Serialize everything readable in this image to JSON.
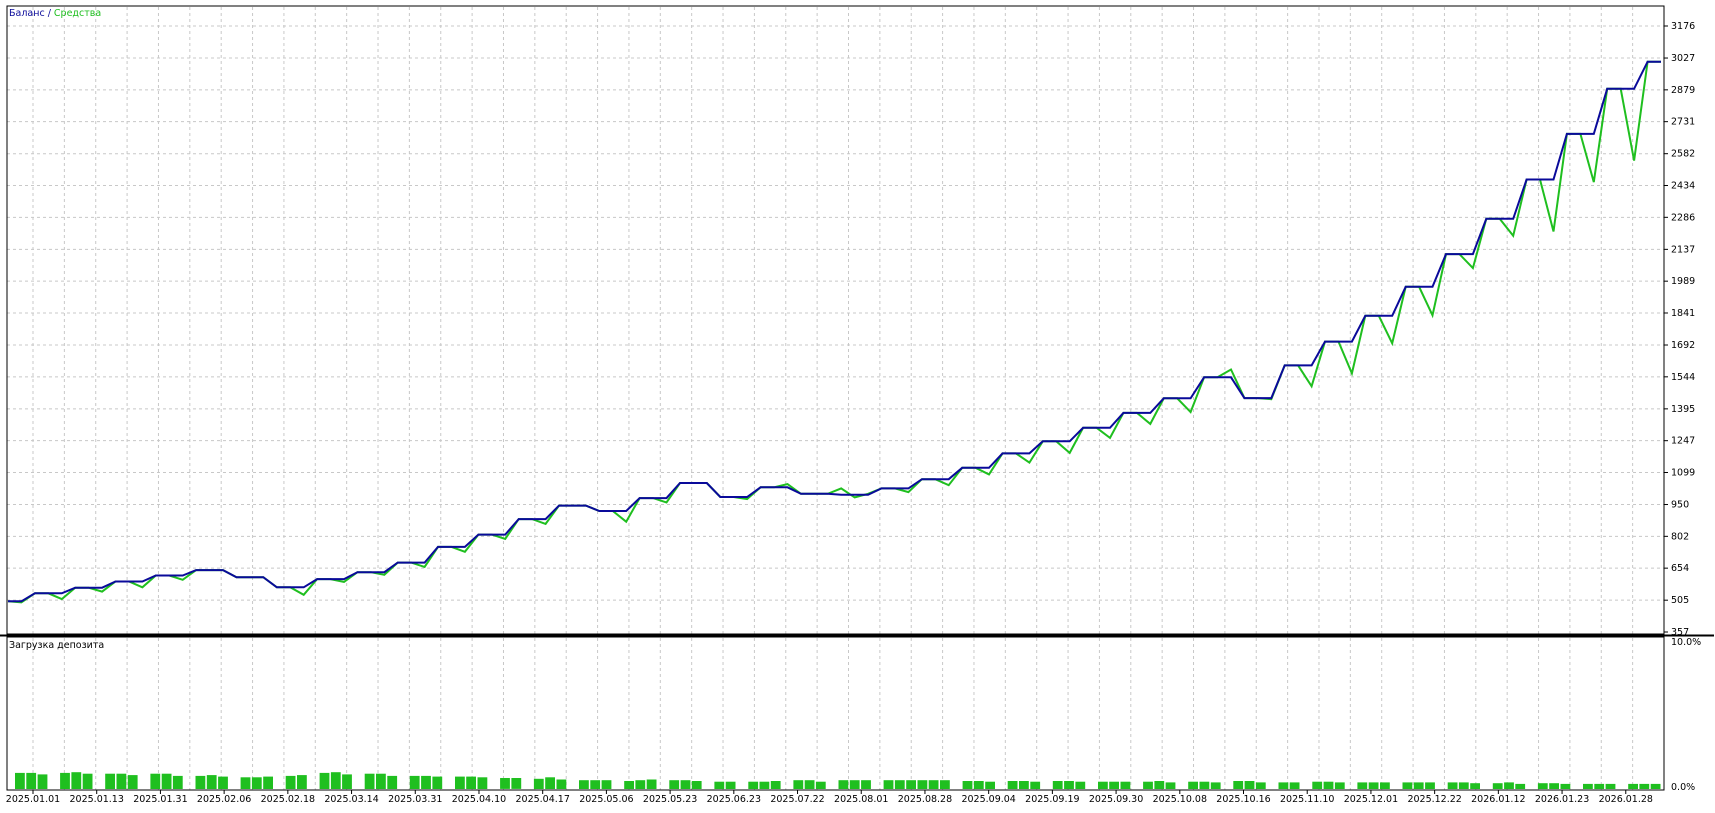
{
  "legend": {
    "balance_label": "Баланс",
    "separator": " / ",
    "equity_label": "Средства"
  },
  "colors": {
    "balance": "#0a0a9a",
    "equity": "#1fbf1f",
    "grid": "#c8c8c8",
    "frame": "#000000",
    "background": "#ffffff",
    "deposit_bars": "#1fbf1f"
  },
  "chart_data": [
    {
      "type": "line",
      "y_ticks": [
        "357",
        "505",
        "654",
        "802",
        "950",
        "1099",
        "1247",
        "1395",
        "1544",
        "1692",
        "1841",
        "1989",
        "2137",
        "2286",
        "2434",
        "2582",
        "2731",
        "2879",
        "3027",
        "3176"
      ],
      "ylim": [
        357,
        3176
      ],
      "grid": true,
      "legend_position": "top-left",
      "series": [
        {
          "name": "Баланс",
          "values": [
            500,
            500,
            537,
            537,
            537,
            563,
            563,
            563,
            592,
            592,
            592,
            620,
            620,
            620,
            645,
            645,
            645,
            612,
            612,
            612,
            565,
            565,
            565,
            603,
            603,
            603,
            635,
            635,
            635,
            680,
            680,
            680,
            753,
            753,
            753,
            810,
            810,
            810,
            882,
            882,
            882,
            945,
            945,
            945,
            920,
            920,
            920,
            980,
            980,
            980,
            1050,
            1050,
            1050,
            985,
            985,
            985,
            1030,
            1030,
            1030,
            1000,
            1000,
            1000,
            995,
            995,
            995,
            1025,
            1025,
            1025,
            1068,
            1068,
            1068,
            1121,
            1121,
            1121,
            1188,
            1188,
            1188,
            1244,
            1244,
            1244,
            1307,
            1307,
            1307,
            1376,
            1376,
            1376,
            1444,
            1444,
            1444,
            1542,
            1542,
            1542,
            1445,
            1445,
            1445,
            1597,
            1597,
            1597,
            1708,
            1708,
            1708,
            1828,
            1828,
            1828,
            1963,
            1963,
            1963,
            2115,
            2115,
            2115,
            2279,
            2279,
            2279,
            2462,
            2462,
            2462,
            2674,
            2674,
            2674,
            2884,
            2884,
            2884,
            3010,
            3010
          ]
        },
        {
          "name": "Средства",
          "values": [
            500,
            495,
            537,
            537,
            510,
            563,
            563,
            545,
            592,
            592,
            565,
            620,
            620,
            600,
            645,
            645,
            645,
            612,
            612,
            612,
            565,
            565,
            530,
            603,
            603,
            590,
            635,
            635,
            623,
            680,
            680,
            660,
            753,
            753,
            730,
            810,
            810,
            790,
            882,
            882,
            860,
            945,
            945,
            945,
            920,
            920,
            870,
            980,
            980,
            960,
            1050,
            1050,
            1050,
            985,
            985,
            975,
            1030,
            1030,
            1045,
            1000,
            1000,
            1000,
            1025,
            983,
            1000,
            1025,
            1025,
            1008,
            1068,
            1068,
            1040,
            1121,
            1121,
            1090,
            1188,
            1188,
            1145,
            1244,
            1244,
            1190,
            1307,
            1307,
            1260,
            1376,
            1376,
            1325,
            1444,
            1444,
            1380,
            1542,
            1542,
            1578,
            1445,
            1445,
            1440,
            1597,
            1597,
            1500,
            1708,
            1708,
            1560,
            1828,
            1828,
            1700,
            1963,
            1963,
            1830,
            2115,
            2115,
            2050,
            2279,
            2279,
            2200,
            2462,
            2462,
            2220,
            2674,
            2674,
            2450,
            2884,
            2884,
            2550,
            3010,
            3010
          ]
        }
      ]
    },
    {
      "type": "bar",
      "label": "Загрузка депозита",
      "y_ticks": [
        "10.0%",
        "0.0%"
      ],
      "ylim": [
        0,
        10
      ],
      "x_ticks": [
        "2025.01.01",
        "2025.01.13",
        "2025.01.31",
        "2025.02.06",
        "2025.02.18",
        "2025.03.14",
        "2025.03.31",
        "2025.04.10",
        "2025.04.17",
        "2025.05.06",
        "2025.05.23",
        "2025.06.23",
        "2025.07.22",
        "2025.08.01",
        "2025.08.28",
        "2025.09.04",
        "2025.09.19",
        "2025.09.30",
        "2025.10.08",
        "2025.10.16",
        "2025.11.10",
        "2025.12.01",
        "2025.12.22",
        "2026.01.12",
        "2026.01.23",
        "2026.01.28"
      ],
      "values": [
        1.1,
        1.1,
        1.0,
        0.0,
        1.1,
        1.15,
        1.05,
        0.0,
        1.05,
        1.05,
        0.95,
        0.0,
        1.05,
        1.05,
        0.9,
        0.0,
        0.9,
        0.95,
        0.85,
        0.0,
        0.8,
        0.8,
        0.85,
        0.0,
        0.9,
        0.95,
        0.0,
        1.1,
        1.15,
        1.0,
        0.0,
        1.05,
        1.05,
        0.9,
        0.0,
        0.9,
        0.9,
        0.85,
        0.0,
        0.85,
        0.85,
        0.8,
        0.0,
        0.75,
        0.75,
        0.0,
        0.7,
        0.8,
        0.65,
        0.0,
        0.6,
        0.6,
        0.6,
        0.0,
        0.55,
        0.6,
        0.65,
        0.0,
        0.6,
        0.6,
        0.55,
        0.0,
        0.5,
        0.5,
        0.0,
        0.5,
        0.5,
        0.55,
        0.0,
        0.6,
        0.6,
        0.5,
        0.0,
        0.6,
        0.6,
        0.6,
        0.0,
        0.6,
        0.6,
        0.6,
        0.6,
        0.6,
        0.6,
        0.0,
        0.55,
        0.55,
        0.5,
        0.0,
        0.55,
        0.55,
        0.5,
        0.0,
        0.55,
        0.55,
        0.5,
        0.0,
        0.5,
        0.5,
        0.5,
        0.0,
        0.5,
        0.55,
        0.45,
        0.0,
        0.5,
        0.5,
        0.45,
        0.0,
        0.55,
        0.55,
        0.45,
        0.0,
        0.45,
        0.45,
        0.0,
        0.5,
        0.5,
        0.45,
        0.0,
        0.45,
        0.45,
        0.45,
        0.0,
        0.45,
        0.45,
        0.45,
        0.0,
        0.45,
        0.45,
        0.4,
        0.0,
        0.4,
        0.45,
        0.35,
        0.0,
        0.4,
        0.4,
        0.35,
        0.0,
        0.35,
        0.35,
        0.35,
        0.0,
        0.35,
        0.35,
        0.35
      ]
    }
  ]
}
